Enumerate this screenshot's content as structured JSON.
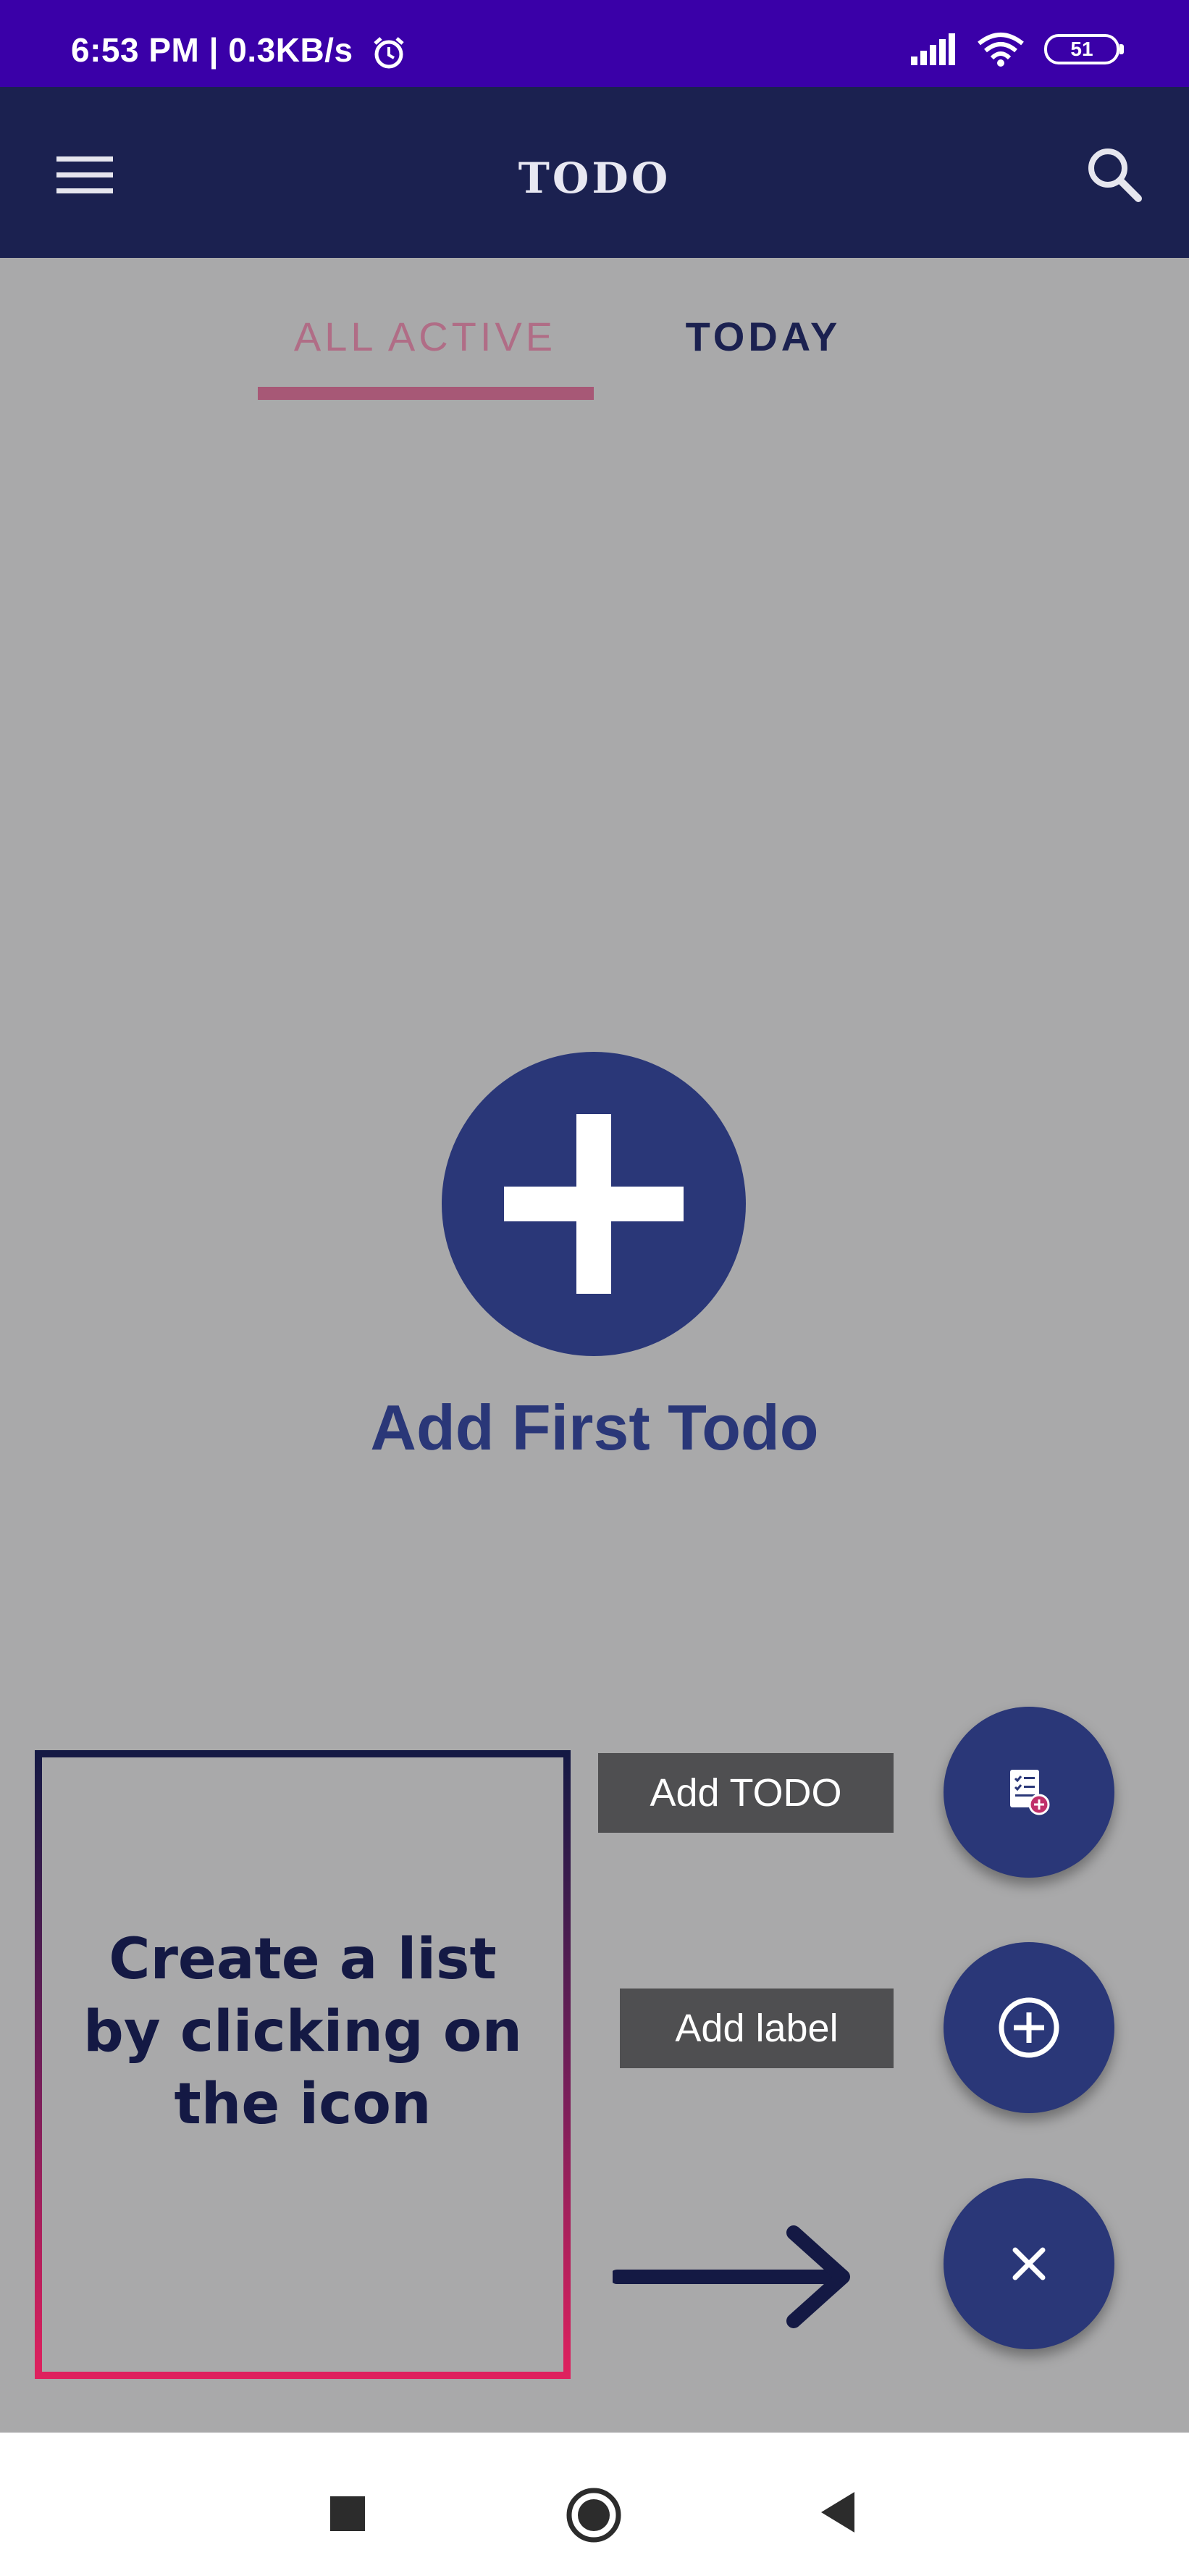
{
  "status_bar": {
    "time": "6:53 PM | 0.3KB/s",
    "battery": "51"
  },
  "app_bar": {
    "title": "TODO"
  },
  "tabs": [
    {
      "label": "ALL ACTIVE",
      "selected": true
    },
    {
      "label": "TODAY",
      "selected": false
    }
  ],
  "empty_state": {
    "label": "Add First Todo"
  },
  "fab_menu": {
    "add_todo_tooltip": "Add TODO",
    "add_label_tooltip": "Add label"
  },
  "annotation": {
    "text": "Create a list by clicking on the icon"
  },
  "colors": {
    "status_bar": "#3a00a8",
    "app_bar": "#1b2150",
    "primary": "#2a3778",
    "tab_selected": "#b06d86",
    "overlay_background": "#a9a9aa"
  },
  "icons": {
    "menu": "hamburger-menu-icon",
    "search": "search-icon",
    "add_todo": "add-note-icon",
    "add_label": "add-circle-icon",
    "close": "close-icon",
    "alarm": "alarm-clock-icon",
    "signal": "signal-icon",
    "wifi": "wifi-icon"
  }
}
